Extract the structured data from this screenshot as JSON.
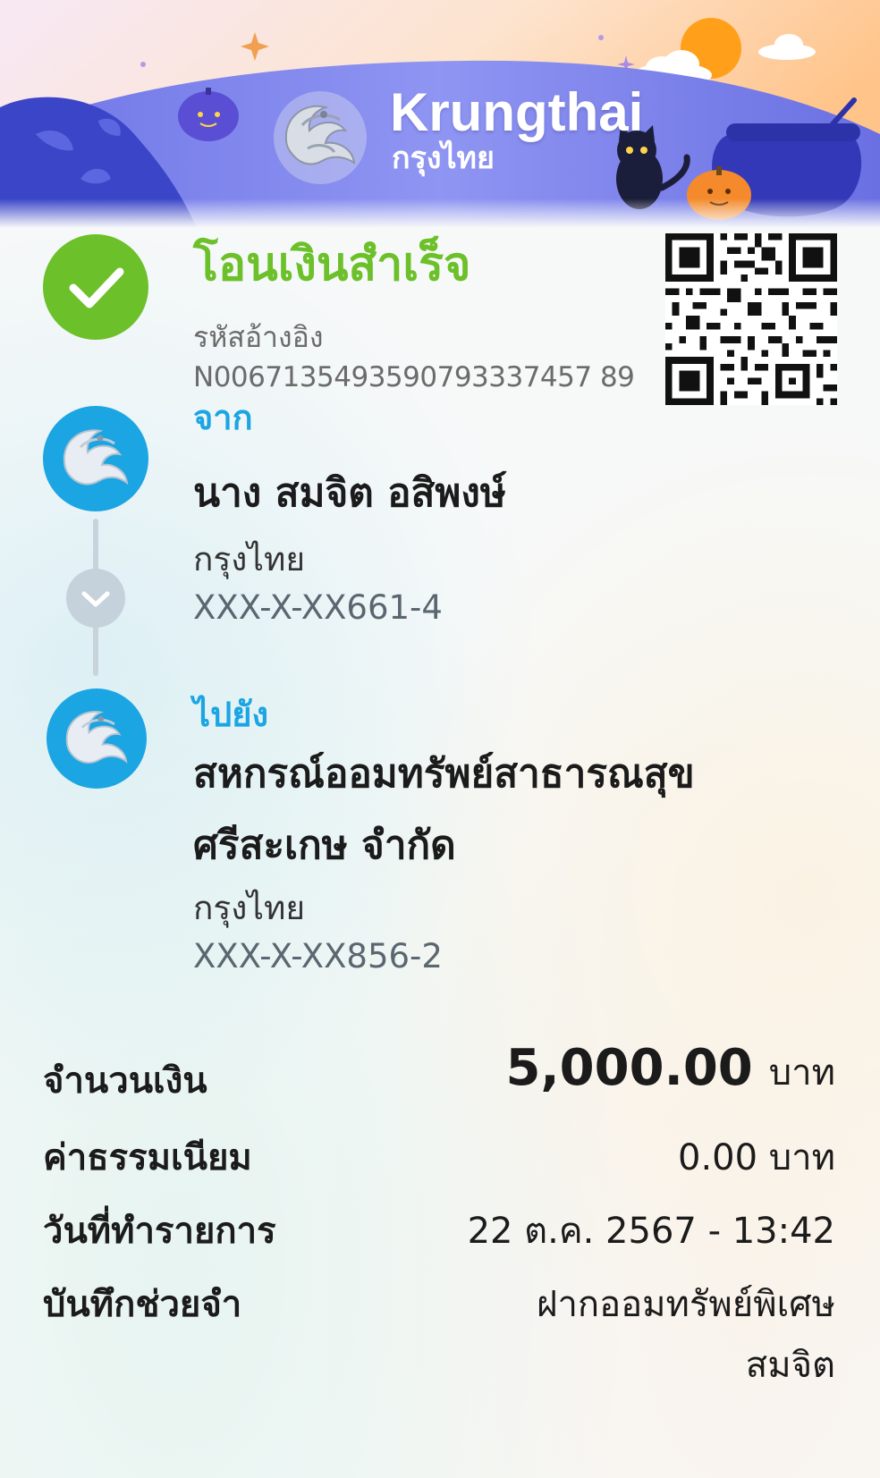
{
  "banner": {
    "brand_name": "Krungthai",
    "brand_sub": "กรุงไทย",
    "logo_icon": "krungthai-phoenix-icon",
    "theme": "halloween",
    "colors": {
      "sky_top": "#f6e6f3",
      "sky_bottom": "#ffd7a8",
      "banner_purple": "#7f86ee",
      "hill_dark": "#3a45c8",
      "sun": "#ff9f1a",
      "pumpkin_orange": "#f48a2b",
      "pumpkin_purple": "#5a4fd4"
    }
  },
  "status": {
    "icon": "check-icon",
    "title": "โอนเงินสำเร็จ",
    "ref_label": "รหัสอ้างอิง",
    "ref_value": "N0067135493590793337457 89",
    "color": "#6cc02a"
  },
  "qr": {
    "icon": "qr-code-icon"
  },
  "from": {
    "label": "จาก",
    "name": "นาง สมจิต อสิพงษ์",
    "bank": "กรุงไทย",
    "account": "XXX-X-XX661-4",
    "avatar_icon": "krungthai-phoenix-icon"
  },
  "connector": {
    "icon": "chevron-down-icon"
  },
  "to": {
    "label": "ไปยัง",
    "name": "สหกรณ์ออมทรัพย์สาธารณสุขศรีสะเกษ จำกัด",
    "bank": "กรุงไทย",
    "account": "XXX-X-XX856-2",
    "avatar_icon": "krungthai-phoenix-icon"
  },
  "details": {
    "amount_label": "จำนวนเงิน",
    "amount_value": "5,000.00",
    "amount_unit": "บาท",
    "fee_label": "ค่าธรรมเนียม",
    "fee_value": "0.00 บาท",
    "date_label": "วันที่ทำรายการ",
    "date_value": "22 ต.ค. 2567 - 13:42",
    "memo_label": "บันทึกช่วยจำ",
    "memo_value": "ฝากออมทรัพย์พิเศษ สมจิต"
  },
  "accent_blue": "#1ba5e2"
}
